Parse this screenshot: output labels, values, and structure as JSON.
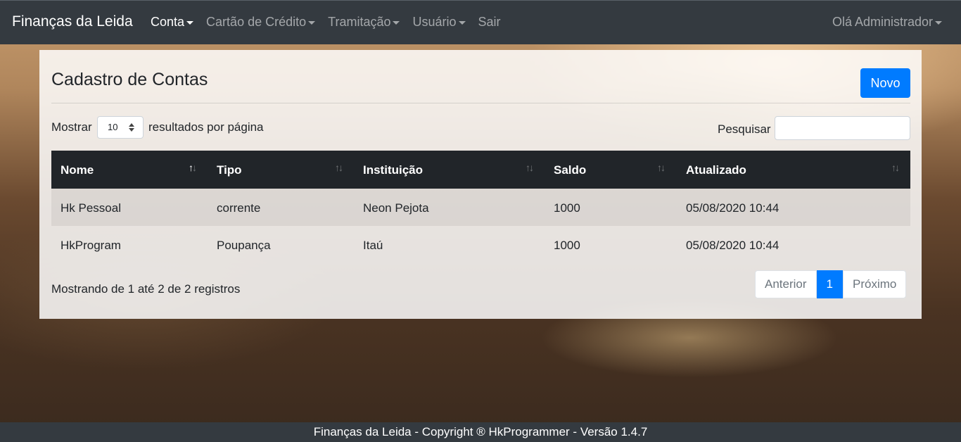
{
  "navbar": {
    "brand": "Finanças da Leida",
    "items": [
      {
        "label": "Conta",
        "dropdown": true,
        "active": true
      },
      {
        "label": "Cartão de Crédito",
        "dropdown": true,
        "active": false
      },
      {
        "label": "Tramitação",
        "dropdown": true,
        "active": false
      },
      {
        "label": "Usuário",
        "dropdown": true,
        "active": false
      },
      {
        "label": "Sair",
        "dropdown": false,
        "active": false
      }
    ],
    "user": "Olá Administrador"
  },
  "card": {
    "title": "Cadastro de Contas",
    "new_button": "Novo"
  },
  "length": {
    "prefix": "Mostrar",
    "value": "10",
    "suffix": "resultados por página"
  },
  "search": {
    "label": "Pesquisar",
    "value": "",
    "placeholder": ""
  },
  "table": {
    "columns": [
      "Nome",
      "Tipo",
      "Instituição",
      "Saldo",
      "Atualizado"
    ],
    "rows": [
      [
        "Hk Pessoal",
        "corrente",
        "Neon Pejota",
        "1000",
        "05/08/2020 10:44"
      ],
      [
        "HkProgram",
        "Poupança",
        "Itaú",
        "1000",
        "05/08/2020 10:44"
      ]
    ]
  },
  "info": "Mostrando de 1 até 2 de 2 registros",
  "pagination": {
    "previous": "Anterior",
    "current": "1",
    "next": "Próximo"
  },
  "footer": "Finanças da Leida - Copyright ® HkProgrammer - Versão 1.4.7",
  "colors": {
    "navbar": "#343a40",
    "primary": "#007bff",
    "table_head": "#212529"
  }
}
